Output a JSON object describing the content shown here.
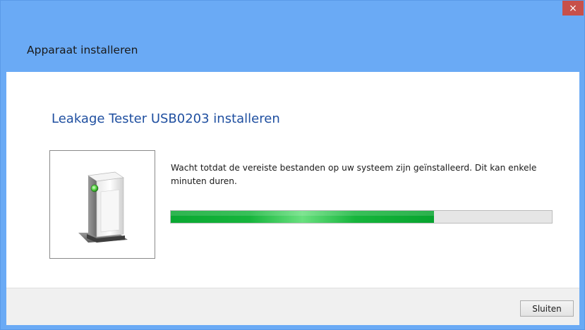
{
  "window": {
    "title": "Apparaat installeren",
    "close_glyph": "×"
  },
  "main": {
    "heading": "Leakage Tester USB0203 installeren",
    "description": "Wacht totdat de vereiste bestanden op uw systeem zijn geïnstalleerd. Dit kan enkele minuten duren.",
    "device_icon": "computer-tower-icon",
    "progress_fraction": 0.69
  },
  "footer": {
    "close_button_label": "Sluiten"
  },
  "colors": {
    "title_bar": "#6aaaf5",
    "heading": "#1f4fa0",
    "progress": "#16b53c",
    "close_button_bg": "#c7504a"
  }
}
